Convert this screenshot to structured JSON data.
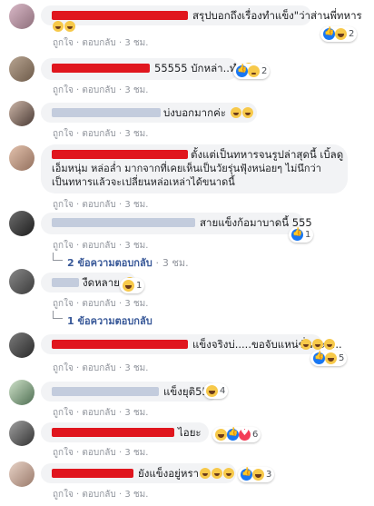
{
  "comments": [
    {
      "name": "",
      "text": "สรุปบอกถึงเรื่องทำแข็ง\"ว่าส่านพี่ทหาร",
      "meta": {
        "like": "ถูกใจ",
        "reply": "ตอบกลับ",
        "time": "3 ชม."
      },
      "reaction_count": "2",
      "reaction_icons": [
        "like-icon",
        "laugh-icon"
      ]
    },
    {
      "name": "",
      "text": "55555 บักหล่า..ทำ",
      "meta": {
        "like": "ถูกใจ",
        "reply": "ตอบกลับ",
        "time": "3 ชม."
      },
      "reaction_count": "2",
      "reaction_icons": [
        "like-icon",
        "sad-icon"
      ]
    },
    {
      "name": "",
      "text": "บ่งบอกมากค่ะ",
      "meta": {
        "like": "ถูกใจ",
        "reply": "ตอบกลับ",
        "time": "3 ชม."
      },
      "reaction_count": "",
      "reaction_icons": []
    },
    {
      "name": "",
      "text_lines": [
        "ตั้งแต่เป็นทหารจนรูปล่าสุดนี้ เบิ้ลดู",
        "เอ็มหนุ่ม หล่อล่ำ มากจากที่เคยเห็นเป็นวัยรุ่นฟุ้งหน่อยๆ ไม่นึกว่า",
        "เป็นทหารแล้วจะเปลี่ยนหล่อเหล่าได้ขนาดนี้"
      ],
      "meta": {
        "like": "ถูกใจ",
        "reply": "ตอบกลับ",
        "time": "3 ชม."
      },
      "reaction_count": "",
      "reaction_icons": []
    },
    {
      "name": "",
      "text": "สายแข็งก้อมาบาดนี้ 555",
      "meta": {
        "like": "ถูกใจ",
        "reply": "ตอบกลับ",
        "time": "3 ชม."
      },
      "reaction_count": "1",
      "reaction_icons": [
        "like-icon"
      ]
    },
    {
      "name": "",
      "text": "งืดหลาย",
      "meta": {
        "like": "ถูกใจ",
        "reply": "ตอบกลับ",
        "time": "3 ชม."
      },
      "reaction_count": "1",
      "reaction_icons": [
        "laugh-icon"
      ]
    },
    {
      "name": "",
      "text": "แข็งจริงบ่.....ขอจับแหน่ชั่นน่ะ.....",
      "meta": {
        "like": "ถูกใจ",
        "reply": "ตอบกลับ",
        "time": "3 ชม."
      },
      "reaction_count": "5",
      "reaction_icons": [
        "like-icon",
        "laugh-icon"
      ]
    },
    {
      "name": "",
      "text": "แข็งยุติ555",
      "meta": {
        "like": "ถูกใจ",
        "reply": "ตอบกลับ",
        "time": "3 ชม."
      },
      "reaction_count": "4",
      "reaction_icons": [
        "laugh-icon"
      ]
    },
    {
      "name": "",
      "text": "ไอยะ",
      "meta": {
        "like": "ถูกใจ",
        "reply": "ตอบกลับ",
        "time": "3 ชม."
      },
      "reaction_count": "6",
      "reaction_icons": [
        "laugh-icon",
        "like-icon",
        "heart-icon"
      ]
    },
    {
      "name": "",
      "text": "ยังแข็งอยู่หรา",
      "meta": {
        "like": "ถูกใจ",
        "reply": "ตอบกลับ",
        "time": "3 ชม."
      },
      "reaction_count": "3",
      "reaction_icons": [
        "like-icon",
        "laugh-icon"
      ]
    }
  ],
  "replies": [
    {
      "text": "2 ข้อความตอบกลับ",
      "time": "3 ชม."
    },
    {
      "text": "1 ข้อความตอบกลับ"
    }
  ],
  "colors": {
    "link": "#385898",
    "redaction": "#e0161e",
    "bubble": "#f2f3f5",
    "meta": "#90949c"
  }
}
